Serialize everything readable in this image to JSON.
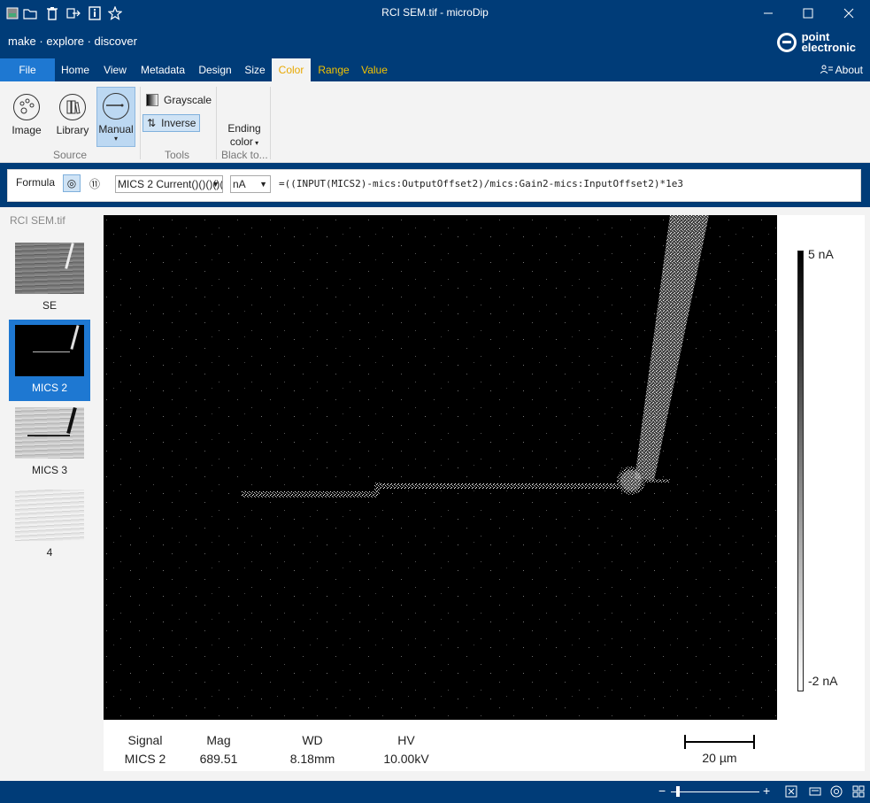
{
  "window": {
    "title": "RCI SEM.tif - microDip"
  },
  "brand": {
    "tagline": "make · explore · discover",
    "logo_line1": "point",
    "logo_line2": "electronic"
  },
  "menu": {
    "file": "File",
    "tabs": [
      "Home",
      "View",
      "Metadata",
      "Design",
      "Size",
      "Color",
      "Range",
      "Value"
    ],
    "about": "About"
  },
  "ribbon": {
    "source": {
      "image": "Image",
      "library": "Library",
      "manual": "Manual",
      "label": "Source"
    },
    "tools": {
      "grayscale": "Grayscale",
      "inverse": "Inverse",
      "label": "Tools"
    },
    "ending": {
      "line1": "Ending",
      "line2": "color",
      "label": "Black to..."
    }
  },
  "formula": {
    "label": "Formula",
    "channel": "MICS 2 Current()()()()(",
    "unit": "nA",
    "expression": "=((INPUT(MICS2)-mics:OutputOffset2)/mics:Gain2-mics:InputOffset2)*1e3"
  },
  "sidebar": {
    "file": "RCI SEM.tif",
    "items": [
      "SE",
      "MICS 2",
      "MICS 3",
      "4"
    ]
  },
  "metadata": {
    "signal_label": "Signal",
    "signal_value": "MICS 2",
    "mag_label": "Mag",
    "mag_value": "689.51",
    "wd_label": "WD",
    "wd_value": "8.18mm",
    "hv_label": "HV",
    "hv_value": "10.00kV",
    "scale_bar": "20 µm"
  },
  "colorbar": {
    "max": "5 nA",
    "min": "-2 nA"
  },
  "colors": {
    "chrome": "#003c78",
    "file_tab": "#1e78d2",
    "accent_tab": "#f2c200"
  }
}
